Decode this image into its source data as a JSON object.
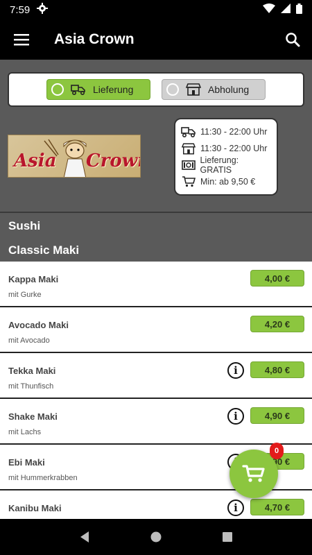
{
  "status": {
    "time": "7:59"
  },
  "appbar": {
    "title": "Asia Crown"
  },
  "mode": {
    "options": [
      {
        "label": "Lieferung",
        "icon": "delivery-scooter-icon",
        "selected": true
      },
      {
        "label": "Abholung",
        "icon": "store-icon",
        "selected": false
      }
    ]
  },
  "restaurant": {
    "logo_text_left": "Asia",
    "logo_text_right": "Crown",
    "info": [
      {
        "icon": "delivery-scooter-icon",
        "text": "11:30 - 22:00 Uhr"
      },
      {
        "icon": "store-icon",
        "text": "11:30 - 22:00 Uhr"
      },
      {
        "icon": "cash-icon",
        "text": "Lieferung: GRATIS"
      },
      {
        "icon": "cart-icon",
        "text": "Min: ab 9,50 €"
      }
    ]
  },
  "sections": {
    "category": "Sushi",
    "subcategory": "Classic Maki"
  },
  "items": [
    {
      "name": "Kappa Maki",
      "desc": "mit Gurke",
      "price": "4,00 €",
      "has_info": false
    },
    {
      "name": "Avocado Maki",
      "desc": "mit Avocado",
      "price": "4,20 €",
      "has_info": false
    },
    {
      "name": "Tekka Maki",
      "desc": "mit Thunfisch",
      "price": "4,80 €",
      "has_info": true
    },
    {
      "name": "Shake Maki",
      "desc": "mit Lachs",
      "price": "4,90 €",
      "has_info": true
    },
    {
      "name": "Ebi Maki",
      "desc": "mit Hummerkrabben",
      "price": "4,90 €",
      "has_info": true
    },
    {
      "name": "Kanibu Maki",
      "desc": "",
      "price": "4,70 €",
      "has_info": true
    }
  ],
  "cart": {
    "count": "0"
  },
  "colors": {
    "accent": "#8cc63f",
    "badge": "#e31b1b"
  }
}
